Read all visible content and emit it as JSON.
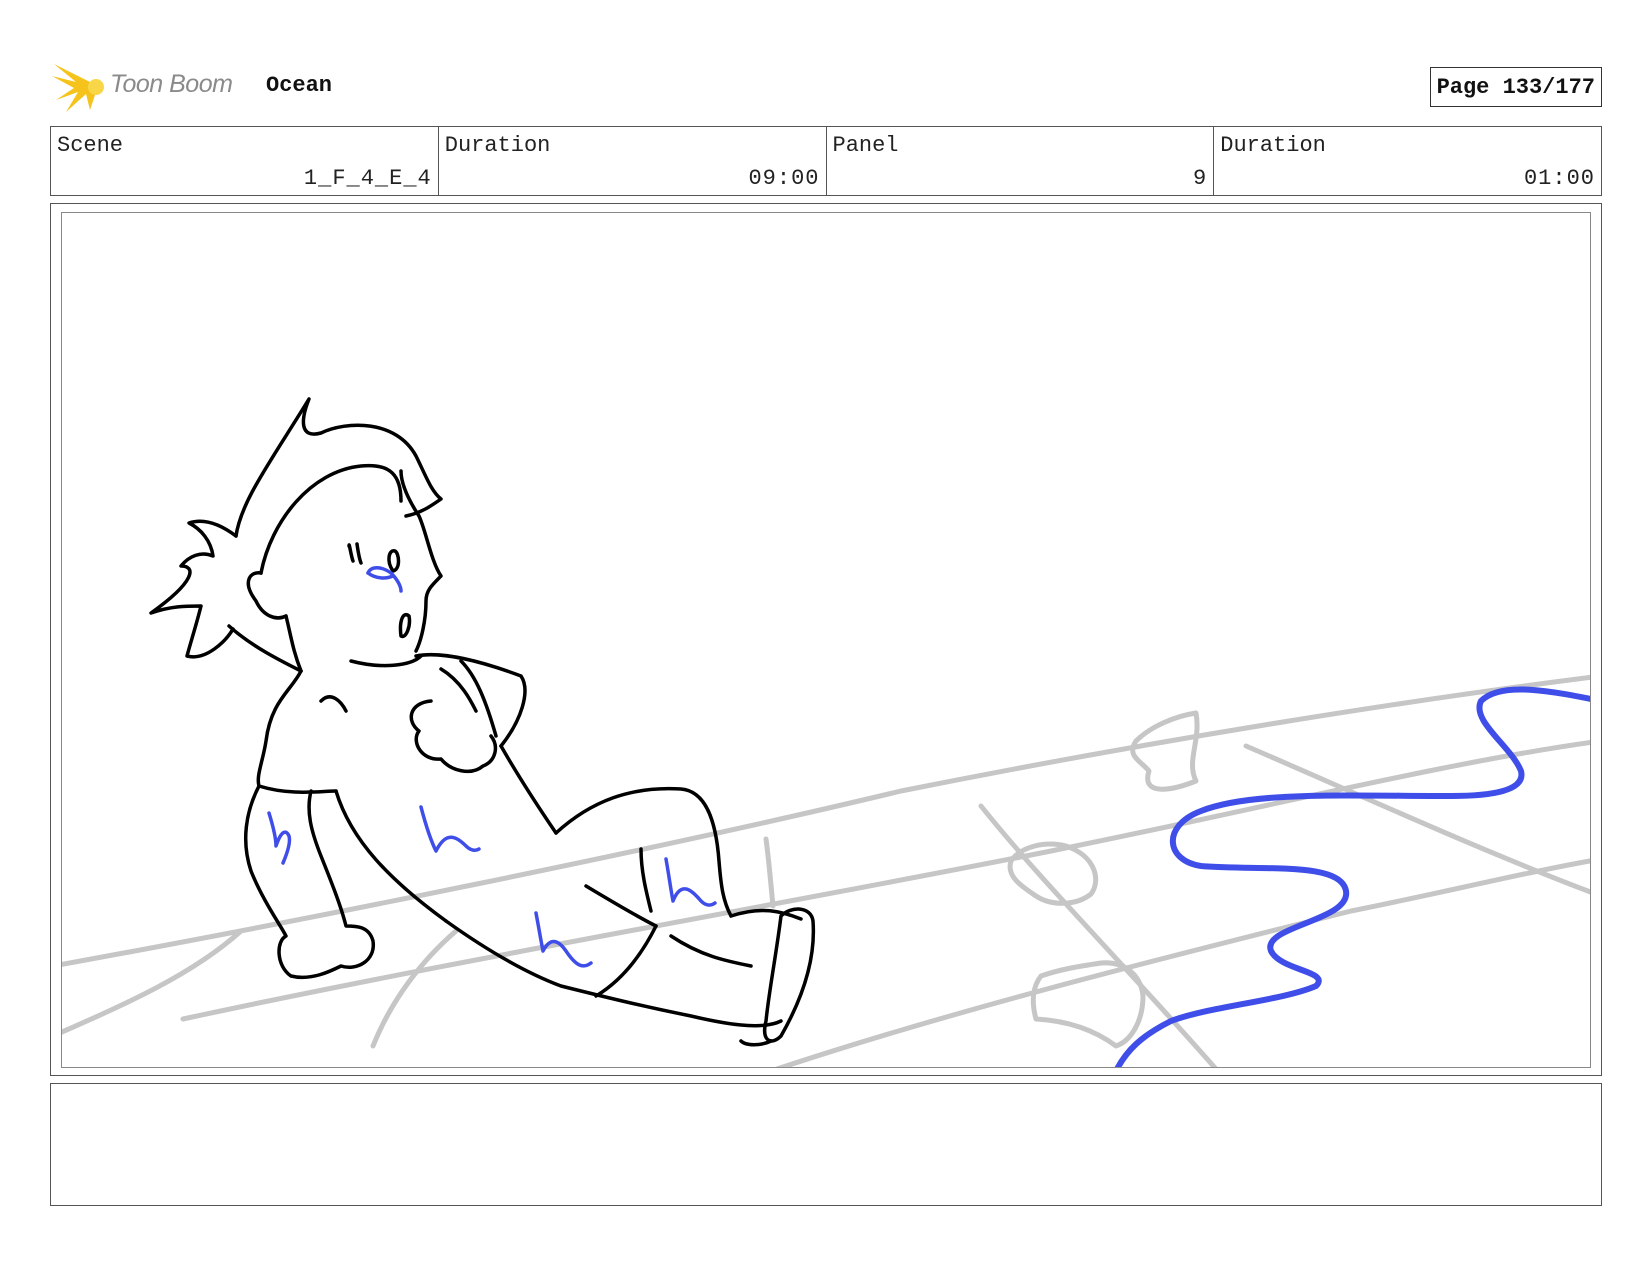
{
  "header": {
    "brand_name": "Toon Boom",
    "project_title": "Ocean",
    "page_label": "Page 133/177"
  },
  "info": {
    "scene_label": "Scene",
    "scene_value": "1_F_4_E_4",
    "scene_duration_label": "Duration",
    "scene_duration_value": "09:00",
    "panel_label": "Panel",
    "panel_value": "9",
    "panel_duration_label": "Duration",
    "panel_duration_value": "01:00"
  },
  "panel": {
    "sketch_description_icon": "storyboard-sketch",
    "ink_color": "#000000",
    "accent_color": "#3f4ee8",
    "ground_color": "#c6c6c6"
  },
  "notes": {
    "text": ""
  }
}
